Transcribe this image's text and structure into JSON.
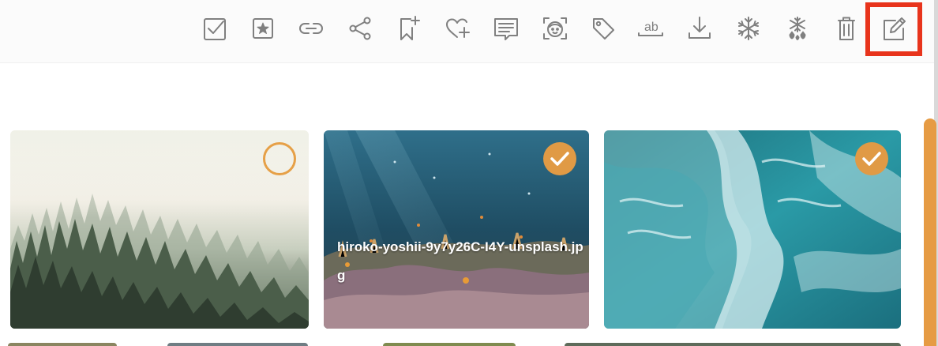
{
  "toolbar": {
    "buttons": [
      {
        "name": "select-all-button",
        "icon": "checkbox-icon"
      },
      {
        "name": "favorite-button",
        "icon": "star-square-icon"
      },
      {
        "name": "link-button",
        "icon": "link-icon"
      },
      {
        "name": "share-button",
        "icon": "share-icon"
      },
      {
        "name": "add-bookmark-button",
        "icon": "bookmark-plus-icon"
      },
      {
        "name": "add-like-button",
        "icon": "heart-plus-icon"
      },
      {
        "name": "comment-button",
        "icon": "comment-icon"
      },
      {
        "name": "face-detect-button",
        "icon": "face-scan-icon"
      },
      {
        "name": "tag-button",
        "icon": "tag-icon"
      },
      {
        "name": "rename-button",
        "icon": "text-ab-icon",
        "glyph": "ab"
      },
      {
        "name": "download-button",
        "icon": "download-icon"
      },
      {
        "name": "freeze-button",
        "icon": "snowflake-icon"
      },
      {
        "name": "unfreeze-button",
        "icon": "snowflake-melt-icon"
      },
      {
        "name": "delete-button",
        "icon": "trash-icon"
      },
      {
        "name": "edit-button",
        "icon": "edit-icon",
        "highlighted": true
      }
    ],
    "highlight_color": "#e8341c",
    "icon_color": "#808080"
  },
  "gallery": {
    "accent_color": "#e09a45",
    "cards": [
      {
        "name": "forest",
        "selected": false,
        "caption": ""
      },
      {
        "name": "coral-reef",
        "selected": true,
        "caption": "hiroko-yoshii-9y7y26C-I4Y-unsplash.jpg"
      },
      {
        "name": "ocean-waves",
        "selected": true,
        "caption": ""
      }
    ]
  },
  "scrollbar": {
    "color": "#e69b43"
  }
}
